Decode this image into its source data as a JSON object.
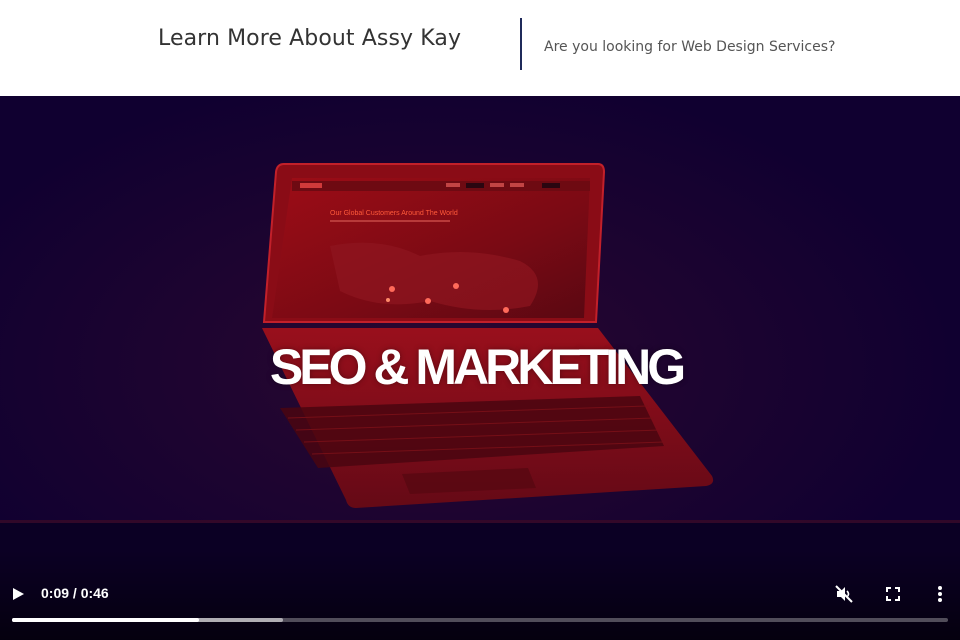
{
  "header": {
    "title": "Learn More About Assy Kay",
    "tagline": "Are you looking for Web Design Services?"
  },
  "video": {
    "overlay_text": "SEO & MARKETING",
    "screen_text": "Our Global Customers Around The World",
    "current_time": "0:09",
    "duration": "0:46",
    "time_display": "0:09 / 0:46",
    "played_fraction": 0.2,
    "buffered_fraction": 0.29,
    "muted": true
  },
  "icons": {
    "play": "play-icon",
    "mute": "volume-muted-icon",
    "fullscreen": "fullscreen-icon",
    "more": "more-vertical-icon"
  },
  "colors": {
    "video_background": "#100030",
    "laptop_red": "#b0101a",
    "divider": "#1f2a5a"
  }
}
